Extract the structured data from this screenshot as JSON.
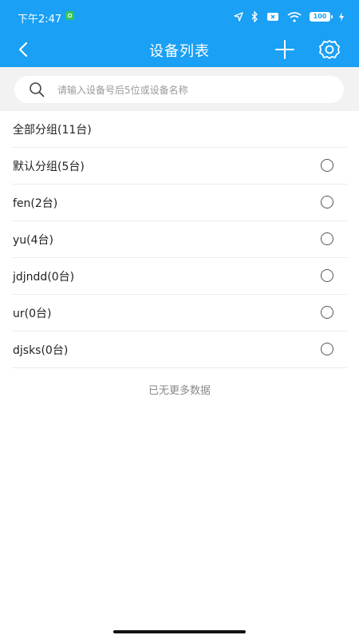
{
  "status_bar": {
    "time": "下午2:47",
    "battery": "100"
  },
  "header": {
    "title": "设备列表"
  },
  "search": {
    "placeholder": "请输入设备号后5位或设备名称",
    "value": ""
  },
  "groups": [
    {
      "label": "全部分组(11台)",
      "has_radio": false
    },
    {
      "label": "默认分组(5台)",
      "has_radio": true
    },
    {
      "label": "fen(2台)",
      "has_radio": true
    },
    {
      "label": "yu(4台)",
      "has_radio": true
    },
    {
      "label": "jdjndd(0台)",
      "has_radio": true
    },
    {
      "label": "ur(0台)",
      "has_radio": true
    },
    {
      "label": "djsks(0台)",
      "has_radio": true
    }
  ],
  "footer": {
    "no_more": "已无更多数据"
  },
  "colors": {
    "accent": "#1aa0f5",
    "search_bg": "#f2f2f2"
  },
  "icons": [
    "back-icon",
    "add-icon",
    "settings-icon",
    "search-icon"
  ]
}
